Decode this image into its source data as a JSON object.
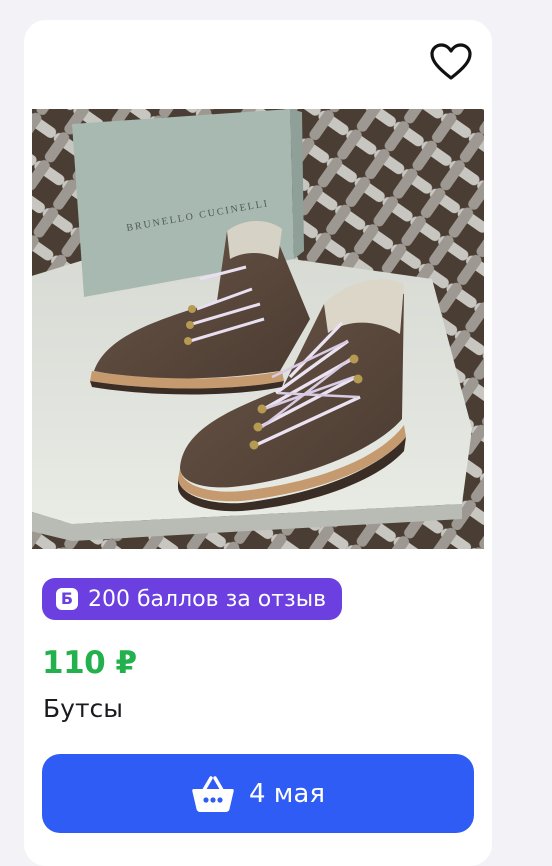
{
  "product_card": {
    "badge": {
      "icon_letter": "Б",
      "text": "200 баллов за отзыв"
    },
    "price": "110 ₽",
    "title": "Бутсы",
    "cart_button": {
      "label": "4 мая"
    },
    "photo": {
      "box_brand_text": "BRUNELLO CUCINELLI"
    },
    "icons": {
      "favorite": "heart-outline-icon",
      "cart": "basket-icon"
    },
    "colors": {
      "price": "#22b14c",
      "badge_bg": "#6b3fe0",
      "button_bg": "#2f5cf5",
      "card_bg": "#ffffff",
      "page_bg": "#f3f3f7"
    }
  }
}
